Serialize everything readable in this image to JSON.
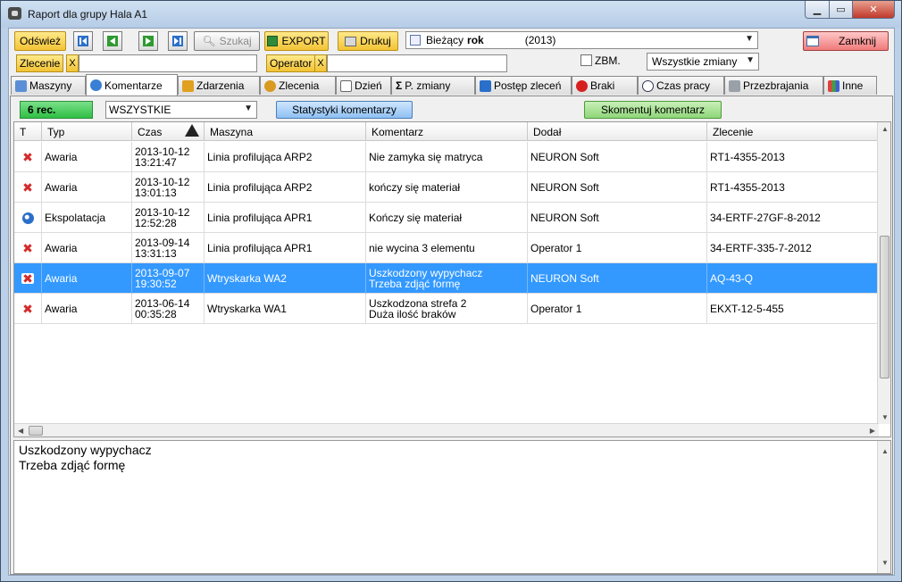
{
  "window": {
    "title": "Raport dla grupy  Hala A1"
  },
  "toolbar": {
    "refresh_label": "Odśwież",
    "search_label": "Szukaj",
    "export_label": "EXPORT",
    "print_label": "Drukuj",
    "period_prefix": "Bieżący",
    "period_value": "rok",
    "period_range": "(2013)",
    "close_label": "Zamknij",
    "order_label": "Zlecenie",
    "operator_label": "Operator",
    "clear_x": "X",
    "zbm_label": "ZBM.",
    "shift_select": "Wszystkie zmiany"
  },
  "tabs": [
    {
      "label": "Maszyny"
    },
    {
      "label": "Komentarze",
      "active": true
    },
    {
      "label": "Zdarzenia"
    },
    {
      "label": "Zlecenia"
    },
    {
      "label": "Dzień"
    },
    {
      "label": "P. zmiany"
    },
    {
      "label": "Postęp zleceń"
    },
    {
      "label": "Braki"
    },
    {
      "label": "Czas pracy"
    },
    {
      "label": "Przezbrajania"
    },
    {
      "label": "Inne"
    }
  ],
  "panel": {
    "rec_count": "6 rec.",
    "filter_value": "WSZYSTKIE",
    "stats_button": "Statystyki komentarzy",
    "comment_button": "Skomentuj komentarz"
  },
  "grid": {
    "columns": [
      "T",
      "Typ",
      "Czas",
      "Maszyna",
      "Komentarz",
      "Dodał",
      "Zlecenie"
    ],
    "rows": [
      {
        "icon": "red-x-icon",
        "typ": "Awaria",
        "date": "2013-10-12",
        "time": "13:21:47",
        "maszyna": "Linia profilująca ARP2",
        "kom1": "Nie zamyka się matryca",
        "kom2": "",
        "dodal": "NEURON Soft",
        "zlecenie": "RT1-4355-2013"
      },
      {
        "icon": "red-x-icon",
        "typ": "Awaria",
        "date": "2013-10-12",
        "time": "13:01:13",
        "maszyna": "Linia profilująca ARP2",
        "kom1": "kończy się materiał",
        "kom2": "",
        "dodal": "NEURON Soft",
        "zlecenie": "RT1-4355-2013"
      },
      {
        "icon": "blue-gear-icon",
        "typ": "Ekspolatacja",
        "date": "2013-10-12",
        "time": "12:52:28",
        "maszyna": "Linia profilująca APR1",
        "kom1": "Kończy się materiał",
        "kom2": "",
        "dodal": "NEURON Soft",
        "zlecenie": "34-ERTF-27GF-8-2012"
      },
      {
        "icon": "red-x-icon",
        "typ": "Awaria",
        "date": "2013-09-14",
        "time": "13:31:13",
        "maszyna": "Linia profilująca APR1",
        "kom1": "nie wycina 3 elementu",
        "kom2": "",
        "dodal": "Operator 1",
        "zlecenie": "34-ERTF-335-7-2012"
      },
      {
        "icon": "red-x-icon",
        "typ": "Awaria",
        "date": "2013-09-07",
        "time": "19:30:52",
        "maszyna": "Wtryskarka WA2",
        "kom1": "Uszkodzony wypychacz",
        "kom2": "Trzeba zdjąć formę",
        "dodal": "NEURON Soft",
        "zlecenie": "AQ-43-Q",
        "selected": true
      },
      {
        "icon": "red-x-icon",
        "typ": "Awaria",
        "date": "2013-06-14",
        "time": "00:35:28",
        "maszyna": "Wtryskarka WA1",
        "kom1": "Uszkodzona strefa 2",
        "kom2": "Duża ilość braków",
        "dodal": "Operator 1",
        "zlecenie": "EKXT-12-5-455"
      }
    ]
  },
  "detail": {
    "line1": "Uszkodzony wypychacz",
    "line2": "Trzeba zdjąć formę"
  },
  "colors": {
    "selected_row": "#3399ff",
    "accent_yellow": "#f2c335",
    "rec_green": "#2fbf44"
  }
}
